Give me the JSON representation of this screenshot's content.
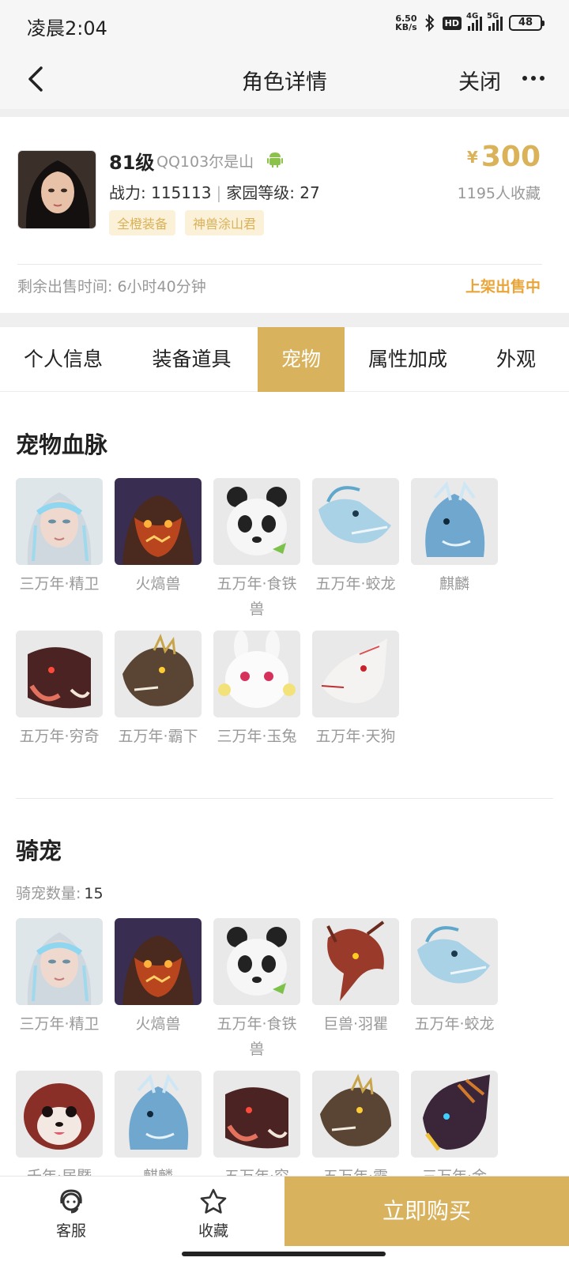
{
  "status": {
    "time": "凌晨2:04",
    "net_speed_value": "6.50",
    "net_speed_unit": "KB/s",
    "hd_label": "HD",
    "sim1_label": "4G",
    "sim2_label": "5G",
    "battery": "48"
  },
  "nav": {
    "title": "角色详情",
    "close_label": "关闭"
  },
  "role": {
    "level": "81级",
    "server": "QQ103尔是山",
    "power_label": "战力: 115113",
    "home_level_label": "家园等级: 27",
    "tags": [
      "全橙装备",
      "神兽涂山君"
    ],
    "price_symbol": "¥",
    "price": "300",
    "fav_count": "1195人收藏",
    "remain_time": "剩余出售时间: 6小时40分钟",
    "sale_status": "上架出售中"
  },
  "tabs": [
    {
      "label": "个人信息",
      "active": false
    },
    {
      "label": "装备道具",
      "active": false
    },
    {
      "label": "宠物",
      "active": true
    },
    {
      "label": "属性加成",
      "active": false
    },
    {
      "label": "外观",
      "active": false
    }
  ],
  "bloodline": {
    "title": "宠物血脉",
    "pets": [
      {
        "name": "三万年·精卫",
        "icon": "jingwei-portrait"
      },
      {
        "name": "火熇兽",
        "icon": "fire-beast-portrait"
      },
      {
        "name": "五万年·食铁兽",
        "icon": "panda-portrait"
      },
      {
        "name": "五万年·蛟龙",
        "icon": "dragon-portrait"
      },
      {
        "name": "麒麟",
        "icon": "qilin-portrait"
      },
      {
        "name": "五万年·穷奇",
        "icon": "qiongqi-portrait"
      },
      {
        "name": "五万年·霸下",
        "icon": "baxia-portrait"
      },
      {
        "name": "三万年·玉兔",
        "icon": "jade-rabbit-portrait"
      },
      {
        "name": "五万年·天狗",
        "icon": "tiangou-portrait"
      }
    ]
  },
  "mounts": {
    "title": "骑宠",
    "count_label": "骑宠数量:",
    "count": "15",
    "pets": [
      {
        "name": "三万年·精卫",
        "icon": "jingwei-portrait"
      },
      {
        "name": "火熇兽",
        "icon": "fire-beast-portrait"
      },
      {
        "name": "五万年·食铁兽",
        "icon": "panda-portrait"
      },
      {
        "name": "巨兽·羽瞿",
        "icon": "yuqu-portrait"
      },
      {
        "name": "五万年·蛟龙",
        "icon": "dragon-portrait"
      },
      {
        "name": "千年·居暨",
        "icon": "juji-portrait"
      },
      {
        "name": "麒麟",
        "icon": "qilin-portrait"
      },
      {
        "name": "五万年·穷",
        "icon": "qiongqi-portrait"
      },
      {
        "name": "五万年·霸",
        "icon": "baxia-portrait"
      },
      {
        "name": "三万年·金",
        "icon": "gold-dragon-portrait"
      }
    ]
  },
  "bottom": {
    "service_label": "客服",
    "favorite_label": "收藏",
    "buy_label": "立即购买"
  },
  "colors": {
    "accent": "#d9b25e",
    "sale_orange": "#eaa53a",
    "tag_bg": "#fbf1d9"
  }
}
